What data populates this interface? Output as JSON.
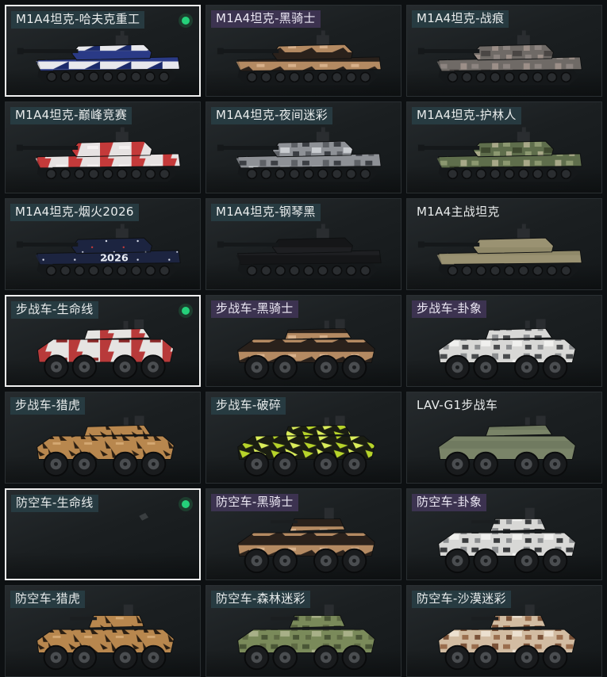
{
  "skins": [
    {
      "name": "M1A4坦克-哈夫克重工",
      "selected": true,
      "equipped": true,
      "kind": "tank",
      "pattern": "haavk",
      "label_style": "teal",
      "camo": [
        "#2a3a86",
        "#e8e8ec",
        "#1b2a6a",
        "#5060b0"
      ]
    },
    {
      "name": "M1A4坦克-黑骑士",
      "selected": false,
      "equipped": false,
      "kind": "tank",
      "pattern": "knight",
      "label_style": "purple",
      "camo": [
        "#b48a62",
        "#2a211b",
        "#d7b08a",
        "#6b5038"
      ]
    },
    {
      "name": "M1A4坦克-战痕",
      "selected": false,
      "equipped": false,
      "kind": "tank",
      "pattern": "camo",
      "label_style": "teal",
      "camo": [
        "#6f6a66",
        "#8c8480",
        "#4a4644",
        "#9c8f88"
      ]
    },
    {
      "name": "M1A4坦克-巅峰竞赛",
      "selected": false,
      "equipped": false,
      "kind": "tank",
      "pattern": "race",
      "label_style": "teal",
      "camo": [
        "#e6e2e2",
        "#c43a3a",
        "#9a2a2a",
        "#f4f0f0"
      ]
    },
    {
      "name": "M1A4坦克-夜间迷彩",
      "selected": false,
      "equipped": false,
      "kind": "tank",
      "pattern": "camo",
      "label_style": "teal",
      "camo": [
        "#8e9196",
        "#3c3f44",
        "#c9ccd0",
        "#5e6166"
      ]
    },
    {
      "name": "M1A4坦克-护林人",
      "selected": false,
      "equipped": false,
      "kind": "tank",
      "pattern": "camo",
      "label_style": "teal",
      "camo": [
        "#5f6e4c",
        "#8c9870",
        "#3f4a30",
        "#a8a888"
      ]
    },
    {
      "name": "M1A4坦克-烟火2026",
      "selected": false,
      "equipped": false,
      "kind": "tank",
      "pattern": "fireworks",
      "label_style": "teal",
      "camo": [
        "#1c2440",
        "#2a3560",
        "#e0e4f0",
        "#c83a3a"
      ],
      "decal": "2026"
    },
    {
      "name": "M1A4坦克-钢琴黑",
      "selected": false,
      "equipped": false,
      "kind": "tank",
      "pattern": "solid",
      "label_style": "teal",
      "camo": [
        "#151618",
        "#222427",
        "#2e3033",
        "#0c0d0e"
      ]
    },
    {
      "name": "M1A4主战坦克",
      "selected": false,
      "equipped": false,
      "kind": "tank",
      "pattern": "solid",
      "label_style": "plain",
      "camo": [
        "#9a9272",
        "#b2aa88",
        "#7e7758",
        "#8a8466"
      ]
    },
    {
      "name": "步战车-生命线",
      "selected": true,
      "equipped": true,
      "kind": "ifv",
      "pattern": "lifeline",
      "label_style": "teal",
      "camo": [
        "#e6e4e2",
        "#b83a3a",
        "#c9c7c5",
        "#8a2828"
      ]
    },
    {
      "name": "步战车-黑骑士",
      "selected": false,
      "equipped": false,
      "kind": "ifv",
      "pattern": "knight",
      "label_style": "purple",
      "camo": [
        "#b48a62",
        "#2a211b",
        "#d7b08a",
        "#6b5038"
      ]
    },
    {
      "name": "步战车-卦象",
      "selected": false,
      "equipped": false,
      "kind": "ifv",
      "pattern": "camo",
      "label_style": "purple",
      "camo": [
        "#d8d8d6",
        "#4a4c4e",
        "#f0f0ee",
        "#8c8e90"
      ]
    },
    {
      "name": "步战车-猎虎",
      "selected": false,
      "equipped": false,
      "kind": "ifv",
      "pattern": "tiger",
      "label_style": "teal",
      "camo": [
        "#b8874e",
        "#2a1e12",
        "#d4a872",
        "#6a4a28"
      ]
    },
    {
      "name": "步战车-破碎",
      "selected": false,
      "equipped": false,
      "kind": "ifv",
      "pattern": "shatter",
      "label_style": "teal",
      "camo": [
        "#b7d42a",
        "#1b1e12",
        "#dbee5a",
        "#3a4418"
      ]
    },
    {
      "name": "LAV-G1步战车",
      "selected": false,
      "equipped": false,
      "kind": "ifv",
      "pattern": "solid",
      "label_style": "plain",
      "camo": [
        "#7a8468",
        "#919a7e",
        "#5e6650",
        "#6e7660"
      ]
    },
    {
      "name": "防空车-生命线",
      "selected": true,
      "equipped": true,
      "kind": "empty",
      "pattern": "none",
      "label_style": "teal",
      "camo": [
        "#888888"
      ]
    },
    {
      "name": "防空车-黑骑士",
      "selected": false,
      "equipped": false,
      "kind": "aa",
      "pattern": "knight",
      "label_style": "purple",
      "camo": [
        "#b48a62",
        "#2a211b",
        "#d7b08a",
        "#6b5038"
      ]
    },
    {
      "name": "防空车-卦象",
      "selected": false,
      "equipped": false,
      "kind": "aa",
      "pattern": "camo",
      "label_style": "purple",
      "camo": [
        "#d8d8d6",
        "#3a3c3e",
        "#f0f0ee",
        "#8c8e90"
      ]
    },
    {
      "name": "防空车-猎虎",
      "selected": false,
      "equipped": false,
      "kind": "aa",
      "pattern": "tiger",
      "label_style": "teal",
      "camo": [
        "#b8874e",
        "#2a1e12",
        "#d4a872",
        "#6a4a28"
      ]
    },
    {
      "name": "防空车-森林迷彩",
      "selected": false,
      "equipped": false,
      "kind": "aa",
      "pattern": "camo",
      "label_style": "teal",
      "camo": [
        "#7a8a5a",
        "#4a5636",
        "#a8b088",
        "#5e6a44"
      ]
    },
    {
      "name": "防空车-沙漠迷彩",
      "selected": false,
      "equipped": false,
      "kind": "aa",
      "pattern": "camo",
      "label_style": "teal",
      "camo": [
        "#d2bca2",
        "#9a6e4e",
        "#ece0d0",
        "#7a5238"
      ]
    }
  ]
}
